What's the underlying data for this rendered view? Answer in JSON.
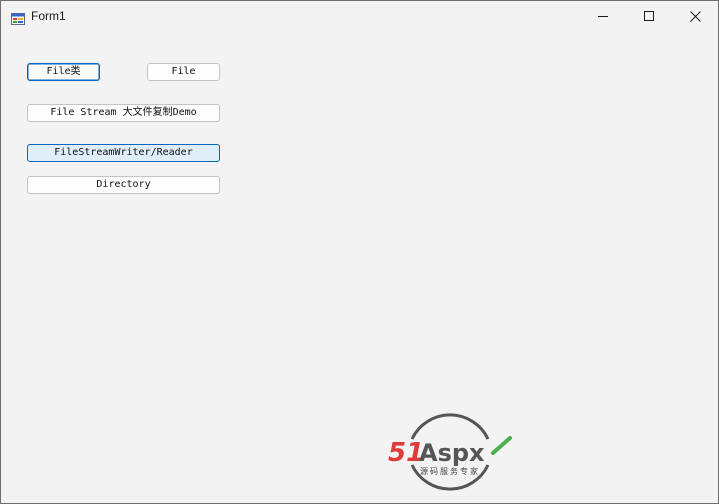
{
  "window": {
    "title": "Form1",
    "icons": {
      "app": "winforms-app-icon",
      "minimize": "minimize-icon",
      "maximize": "maximize-icon",
      "close": "close-icon"
    }
  },
  "buttons": {
    "file_class": "File类",
    "file": "File",
    "file_stream": "File Stream 大文件复制Demo",
    "stream_writer_reader": "FileStreamWriter/Reader",
    "directory": "Directory"
  },
  "watermark": {
    "brand_number": "51",
    "brand_text": "Aspx",
    "tagline": "源码服务专家"
  },
  "colors": {
    "accent": "#0067c0",
    "logo_red": "#e03a3a",
    "logo_green": "#4caf50",
    "logo_gray": "#555555"
  }
}
